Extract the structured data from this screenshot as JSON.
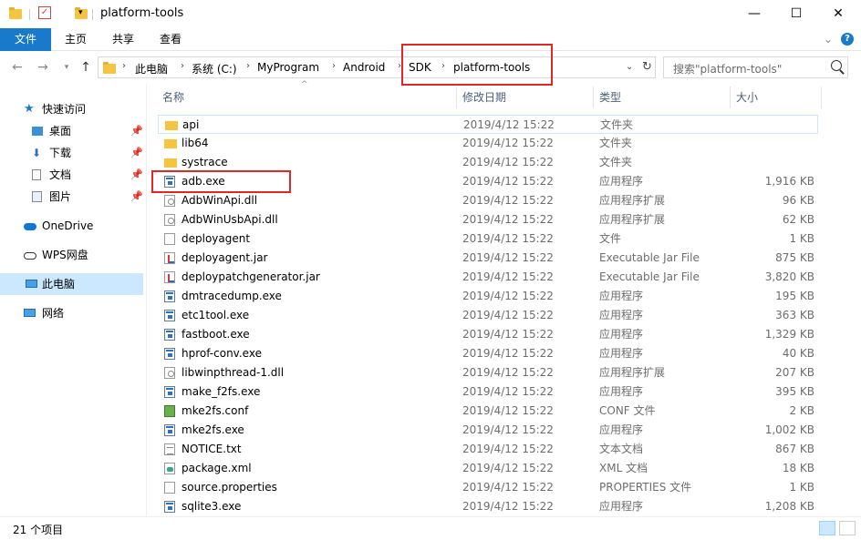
{
  "window": {
    "title": "platform-tools",
    "minimize": "—",
    "maximize": "☐",
    "close": "✕"
  },
  "ribbon": {
    "tabs": [
      "文件",
      "主页",
      "共享",
      "查看"
    ],
    "help": "?",
    "expand": "⌄"
  },
  "address": {
    "breadcrumbs": [
      "此电脑",
      "系统 (C:)",
      "MyProgram",
      "Android",
      "SDK",
      "platform-tools"
    ],
    "search_placeholder": "搜索\"platform-tools\""
  },
  "sidebar": {
    "items": [
      {
        "label": "快速访问",
        "icon": "star-icon"
      },
      {
        "label": "桌面",
        "icon": "desktop-icon",
        "pinned": true
      },
      {
        "label": "下载",
        "icon": "download-icon",
        "pinned": true
      },
      {
        "label": "文档",
        "icon": "document-icon",
        "pinned": true
      },
      {
        "label": "图片",
        "icon": "picture-icon",
        "pinned": true
      },
      {
        "label": "OneDrive",
        "icon": "cloud-icon"
      },
      {
        "label": "WPS网盘",
        "icon": "cloud-icon"
      },
      {
        "label": "此电脑",
        "icon": "computer-icon",
        "selected": true
      },
      {
        "label": "网络",
        "icon": "network-icon"
      }
    ]
  },
  "columns": {
    "name": "名称",
    "date": "修改日期",
    "type": "类型",
    "size": "大小"
  },
  "files": [
    {
      "name": "api",
      "date": "2019/4/12 15:22",
      "type": "文件夹",
      "size": "",
      "icon": "folder"
    },
    {
      "name": "lib64",
      "date": "2019/4/12 15:22",
      "type": "文件夹",
      "size": "",
      "icon": "folder"
    },
    {
      "name": "systrace",
      "date": "2019/4/12 15:22",
      "type": "文件夹",
      "size": "",
      "icon": "folder"
    },
    {
      "name": "adb.exe",
      "date": "2019/4/12 15:22",
      "type": "应用程序",
      "size": "1,916 KB",
      "icon": "exe"
    },
    {
      "name": "AdbWinApi.dll",
      "date": "2019/4/12 15:22",
      "type": "应用程序扩展",
      "size": "96 KB",
      "icon": "dll"
    },
    {
      "name": "AdbWinUsbApi.dll",
      "date": "2019/4/12 15:22",
      "type": "应用程序扩展",
      "size": "62 KB",
      "icon": "dll"
    },
    {
      "name": "deployagent",
      "date": "2019/4/12 15:22",
      "type": "文件",
      "size": "1 KB",
      "icon": "file"
    },
    {
      "name": "deployagent.jar",
      "date": "2019/4/12 15:22",
      "type": "Executable Jar File",
      "size": "875 KB",
      "icon": "jar"
    },
    {
      "name": "deploypatchgenerator.jar",
      "date": "2019/4/12 15:22",
      "type": "Executable Jar File",
      "size": "3,820 KB",
      "icon": "jar"
    },
    {
      "name": "dmtracedump.exe",
      "date": "2019/4/12 15:22",
      "type": "应用程序",
      "size": "195 KB",
      "icon": "exe"
    },
    {
      "name": "etc1tool.exe",
      "date": "2019/4/12 15:22",
      "type": "应用程序",
      "size": "363 KB",
      "icon": "exe"
    },
    {
      "name": "fastboot.exe",
      "date": "2019/4/12 15:22",
      "type": "应用程序",
      "size": "1,329 KB",
      "icon": "exe"
    },
    {
      "name": "hprof-conv.exe",
      "date": "2019/4/12 15:22",
      "type": "应用程序",
      "size": "40 KB",
      "icon": "exe"
    },
    {
      "name": "libwinpthread-1.dll",
      "date": "2019/4/12 15:22",
      "type": "应用程序扩展",
      "size": "207 KB",
      "icon": "dll"
    },
    {
      "name": "make_f2fs.exe",
      "date": "2019/4/12 15:22",
      "type": "应用程序",
      "size": "395 KB",
      "icon": "exe"
    },
    {
      "name": "mke2fs.conf",
      "date": "2019/4/12 15:22",
      "type": "CONF 文件",
      "size": "2 KB",
      "icon": "conf"
    },
    {
      "name": "mke2fs.exe",
      "date": "2019/4/12 15:22",
      "type": "应用程序",
      "size": "1,002 KB",
      "icon": "exe"
    },
    {
      "name": "NOTICE.txt",
      "date": "2019/4/12 15:22",
      "type": "文本文档",
      "size": "867 KB",
      "icon": "txt"
    },
    {
      "name": "package.xml",
      "date": "2019/4/12 15:22",
      "type": "XML 文档",
      "size": "18 KB",
      "icon": "xml"
    },
    {
      "name": "source.properties",
      "date": "2019/4/12 15:22",
      "type": "PROPERTIES 文件",
      "size": "1 KB",
      "icon": "file"
    },
    {
      "name": "sqlite3.exe",
      "date": "2019/4/12 15:22",
      "type": "应用程序",
      "size": "1,208 KB",
      "icon": "exe"
    }
  ],
  "status": {
    "item_count": "21 个项目"
  },
  "colors": {
    "accent": "#1979ca",
    "selection": "#cce8ff",
    "highlight_box": "#e02727"
  }
}
